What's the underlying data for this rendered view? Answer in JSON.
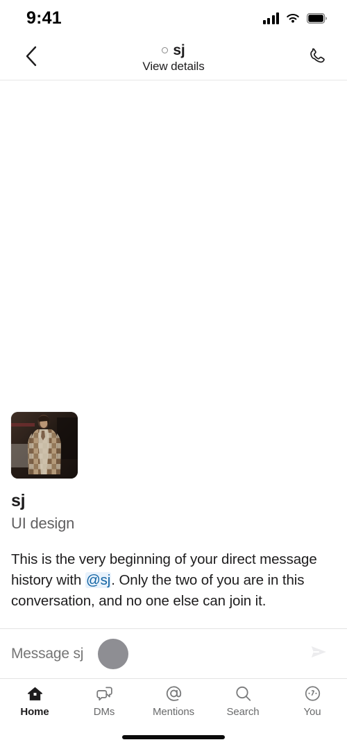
{
  "status_bar": {
    "time": "9:41",
    "signal_icon": "cellular-signal-icon",
    "wifi_icon": "wifi-icon",
    "battery_icon": "battery-full-icon"
  },
  "header": {
    "back_icon": "back-chevron-icon",
    "presence": "offline-presence-dot",
    "title": "sj",
    "subtitle": "View details",
    "call_icon": "phone-call-icon"
  },
  "conversation": {
    "avatar_alt": "sj-avatar-photo",
    "name": "sj",
    "role": "UI design",
    "intro_part1": "This is the very beginning of your direct message history with ",
    "mention": "@sj",
    "intro_part2": ". Only the two of you are in this conversation, and no one else can join it."
  },
  "composer": {
    "placeholder": "Message sj",
    "value": "",
    "send_icon": "send-arrow-icon",
    "touch_indicator": "touch-point-indicator"
  },
  "tabbar": {
    "items": [
      {
        "label": "Home",
        "icon": "home-icon",
        "active": true
      },
      {
        "label": "DMs",
        "icon": "dms-speech-bubbles-icon",
        "active": false
      },
      {
        "label": "Mentions",
        "icon": "at-mention-icon",
        "active": false
      },
      {
        "label": "Search",
        "icon": "search-magnifier-icon",
        "active": false
      },
      {
        "label": "You",
        "icon": "you-profile-icon",
        "active": false
      }
    ]
  },
  "home_indicator": "home-indicator-bar",
  "colors": {
    "text_primary": "#1d1c1d",
    "text_secondary": "#616061",
    "mention_text": "#1264a3",
    "mention_bg": "#e8f2fc",
    "divider": "#e3e3e3",
    "placeholder": "#9b9b9e",
    "touch_dot": "#8e8e93"
  }
}
